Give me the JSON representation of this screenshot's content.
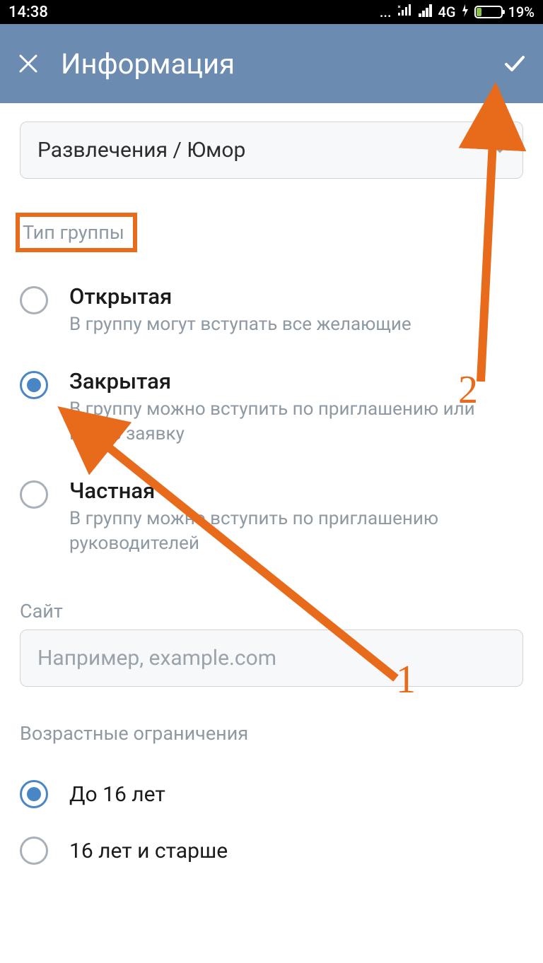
{
  "status": {
    "time": "14:38",
    "dots": "...",
    "network": "4G",
    "battery_pct": "19%"
  },
  "appbar": {
    "title": "Информация"
  },
  "category": {
    "value": "Развлечения / Юмор"
  },
  "group_type": {
    "label": "Тип группы",
    "options": [
      {
        "title": "Открытая",
        "sub": "В группу могут вступать все желающие",
        "selected": false
      },
      {
        "title": "Закрытая",
        "sub": "В группу можно вступить по приглашению или подав заявку",
        "selected": true
      },
      {
        "title": "Частная",
        "sub": "В группу можно вступить по приглашению руководителей",
        "selected": false
      }
    ]
  },
  "site": {
    "label": "Сайт",
    "placeholder": "Например, example.com"
  },
  "age": {
    "label": "Возрастные ограничения",
    "options": [
      {
        "label": "До 16 лет",
        "selected": true
      },
      {
        "label": "16 лет и старше",
        "selected": false
      }
    ]
  },
  "annotation": {
    "step1": "1",
    "step2": "2",
    "color": "#e86b1c"
  }
}
